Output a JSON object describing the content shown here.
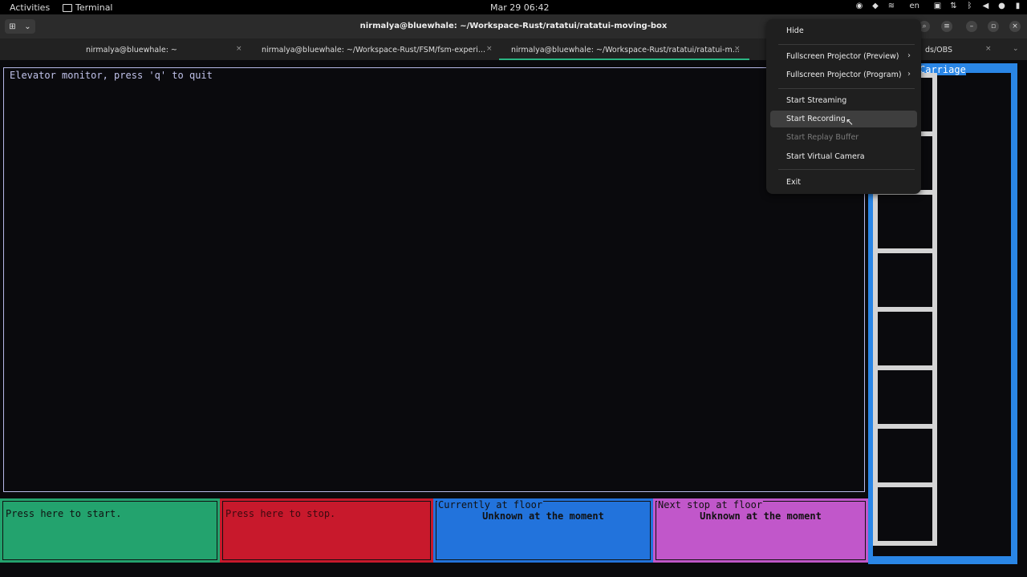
{
  "topbar": {
    "activities": "Activities",
    "app_name": "Terminal",
    "clock": "Mar 29  06:42",
    "lang": "en"
  },
  "window": {
    "title": "nirmalya@bluewhale: ~/Workspace-Rust/ratatui/ratatui-moving-box"
  },
  "tabs": [
    {
      "label": "nirmalya@bluewhale: ~"
    },
    {
      "label": "nirmalya@bluewhale: ~/Workspace-Rust/FSM/fsm-experi..."
    },
    {
      "label": "nirmalya@bluewhale: ~/Workspace-Rust/ratatui/ratatui-m..."
    },
    {
      "label": "ds/OBS"
    }
  ],
  "monitor": {
    "title": "Elevator monitor, press 'q' to quit"
  },
  "panels": {
    "start": "Press here to start.",
    "stop": "Press here to stop.",
    "current_title": "Currently at floor",
    "current_value": "Unknown at the moment",
    "next_title": "Next stop at floor",
    "next_value": "Unknown at the moment"
  },
  "elevator": {
    "title": "Carriage",
    "floors": 8
  },
  "menu": {
    "items": [
      {
        "label": "Hide"
      },
      {
        "label": "Fullscreen Projector (Preview)"
      },
      {
        "label": "Fullscreen Projector (Program)"
      },
      {
        "label": "Start Streaming"
      },
      {
        "label": "Start Recording"
      },
      {
        "label": "Start Replay Buffer"
      },
      {
        "label": "Start Virtual Camera"
      },
      {
        "label": "Exit"
      }
    ]
  },
  "colors": {
    "start_panel": "#23a36e",
    "stop_panel": "#c8192c",
    "current_panel": "#2273dc",
    "next_panel": "#c157ca",
    "carriage_frame": "#2a86e6"
  }
}
